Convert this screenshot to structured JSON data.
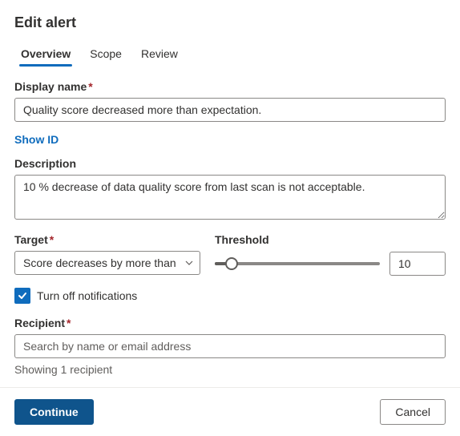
{
  "title": "Edit alert",
  "tabs": {
    "overview": "Overview",
    "scope": "Scope",
    "review": "Review"
  },
  "display_name": {
    "label": "Display name",
    "value": "Quality score decreased more than expectation."
  },
  "show_id": "Show ID",
  "description": {
    "label": "Description",
    "value": "10 % decrease of data quality score from last scan is not acceptable."
  },
  "target": {
    "label": "Target",
    "value": "Score decreases by more than"
  },
  "threshold": {
    "label": "Threshold",
    "value": "10",
    "percent": 10
  },
  "notifications": {
    "label": "Turn off notifications",
    "checked": true
  },
  "recipient": {
    "label": "Recipient",
    "placeholder": "Search by name or email address",
    "hint": "Showing 1 recipient"
  },
  "footer": {
    "continue": "Continue",
    "cancel": "Cancel"
  }
}
